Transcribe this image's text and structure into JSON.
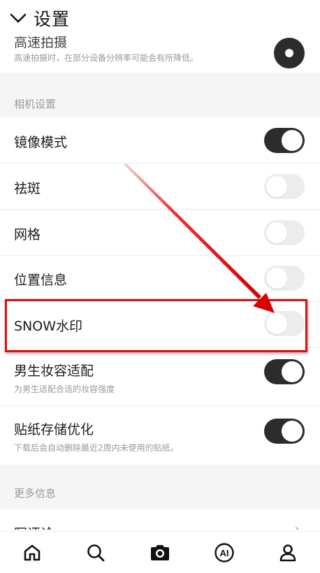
{
  "header": {
    "title": "设置"
  },
  "top_item": {
    "title_partial": "高速拍摄",
    "subtitle": "高速拍摄时，在部分设备分辨率可能会有所降低。",
    "toggle_on": true
  },
  "sections": {
    "camera": {
      "title": "相机设置"
    },
    "more": {
      "title": "更多信息"
    }
  },
  "settings": [
    {
      "label": "镜像模式",
      "on": true
    },
    {
      "label": "祛斑",
      "on": false
    },
    {
      "label": "网格",
      "on": false
    },
    {
      "label": "位置信息",
      "on": false
    },
    {
      "label": "SNOW水印",
      "on": false
    },
    {
      "label": "男生妆容适配",
      "subtitle": "为男生适配合适的妆容强度",
      "on": true
    },
    {
      "label": "贴纸存储优化",
      "subtitle": "下载后会自动删除最近2周内未使用的贴纸。",
      "on": true
    }
  ],
  "more_items": [
    {
      "label": "写评论"
    }
  ],
  "tabbar": {
    "items": [
      {
        "icon": "home-icon"
      },
      {
        "icon": "search-icon"
      },
      {
        "icon": "camera-icon"
      },
      {
        "icon": "ai-icon",
        "label": "AI"
      },
      {
        "icon": "profile-icon"
      }
    ]
  },
  "annotation": {
    "highlight_color": "#e01010"
  },
  "colors": {
    "toggle_on": "#2c2c2c",
    "toggle_off": "#ececec",
    "section_bg": "#f5f5f5"
  }
}
